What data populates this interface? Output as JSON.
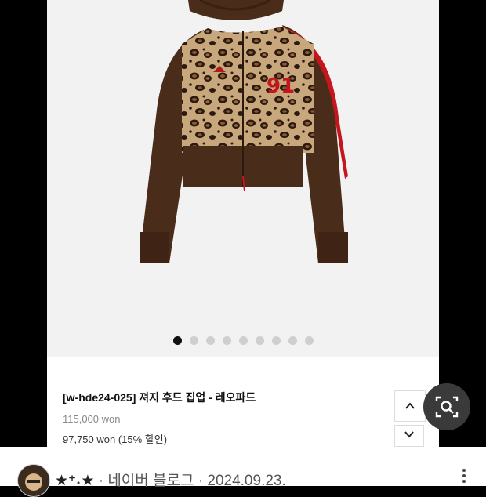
{
  "product": {
    "title": "[w-hde24-025] 져지 후드 집업 - 레오파드",
    "original_price": "115,000 won",
    "sale_price": "97,750 won (15% 할인)",
    "jersey_number": "91",
    "image_count": 9,
    "active_image_index": 0
  },
  "icons": {
    "scroll_up": "chevron-up-icon",
    "scroll_down": "chevron-down-icon",
    "visual_search": "lens-search-icon",
    "more": "more-vert-icon"
  },
  "source": {
    "author": "★⁺˖★",
    "site": "네이버 블로그",
    "separator": "·",
    "date": "2024.09.23."
  },
  "colors": {
    "hoodie_brown": "#4a2c1a",
    "accent_red": "#c4161c",
    "lens_button_bg": "#3a3a3a"
  }
}
